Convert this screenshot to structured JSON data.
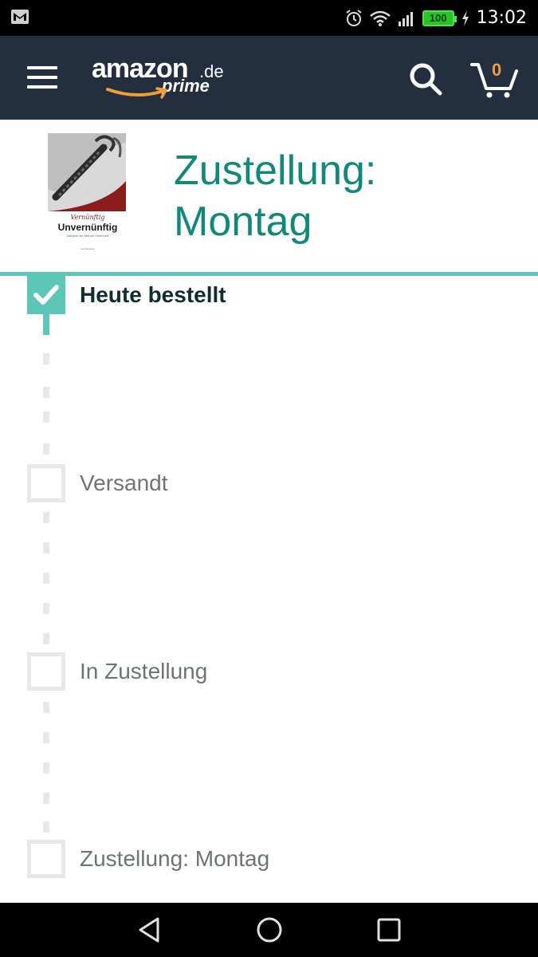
{
  "status_bar": {
    "time": "13:02",
    "battery": "100",
    "icons": [
      "gmail-icon",
      "alarm-icon",
      "wifi-icon",
      "signal-icon",
      "battery-icon",
      "charging-icon"
    ]
  },
  "header": {
    "logo_main": "amazon",
    "logo_tld": ".de",
    "logo_sub": "prime",
    "cart_count": "0",
    "colors": {
      "background": "#232f3e",
      "cart_count": "#f19e39",
      "smile": "#f19e39"
    }
  },
  "delivery": {
    "title_line1": "Zustellung:",
    "title_line2": "Montag",
    "cover": {
      "script_title": "Vernünftig",
      "title": "Unvernünftig",
      "subtitle": "Zwischen der Welt der Unvernunft",
      "author": "Leo Sommer"
    },
    "accent": "#0f8a7a"
  },
  "tracker": {
    "steps": [
      {
        "label": "Heute bestellt",
        "done": true
      },
      {
        "label": "Versandt",
        "done": false
      },
      {
        "label": "In Zustellung",
        "done": false
      },
      {
        "label": "Zustellung: Montag",
        "done": false
      }
    ],
    "accent": "#5cc7b8"
  },
  "nav": {
    "icons": [
      "back-icon",
      "home-icon",
      "recents-icon"
    ]
  }
}
